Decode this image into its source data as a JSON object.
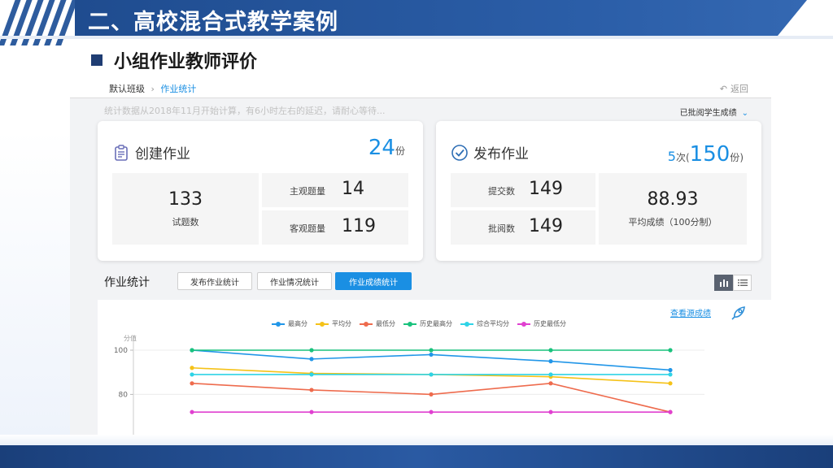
{
  "slide": {
    "title": "二、高校混合式教学案例",
    "subtitle": "小组作业教师评价"
  },
  "topbar": {
    "breadcrumb_root": "默认班级",
    "breadcrumb_sep": "›",
    "breadcrumb_current": "作业统计",
    "back_label": "返回"
  },
  "notice": "统计数据从2018年11月开始计算，有6小时左右的延迟，请耐心等待...",
  "grade_select": "已批阅学生成绩",
  "create_card": {
    "title": "创建作业",
    "total": "24",
    "total_unit": "份",
    "questions_count": "133",
    "questions_label": "试题数",
    "subjective_label": "主观题量",
    "subjective_value": "14",
    "objective_label": "客观题量",
    "objective_value": "119"
  },
  "publish_card": {
    "title": "发布作业",
    "times": "5",
    "times_unit": "次",
    "paren_open": "(",
    "copies": "150",
    "copies_unit": "份",
    "paren_close": ")",
    "submit_label": "提交数",
    "submit_value": "149",
    "review_label": "批阅数",
    "review_value": "149",
    "avg_score": "88.93",
    "avg_label": "平均成绩（100分制）"
  },
  "stats": {
    "section_title": "作业统计",
    "tabs": [
      {
        "label": "发布作业统计",
        "active": false
      },
      {
        "label": "作业情况统计",
        "active": false
      },
      {
        "label": "作业成绩统计",
        "active": true
      }
    ],
    "view_source_link": "查看源成绩"
  },
  "colors": {
    "accent": "#1a8fe3",
    "header_band": "#2b5ea8"
  },
  "chart_data": {
    "type": "line",
    "ylabel": "分值",
    "ylim": [
      70,
      100
    ],
    "yticks": [
      80,
      100
    ],
    "x": [
      1,
      2,
      3,
      4,
      5
    ],
    "legend_position": "top",
    "series": [
      {
        "name": "最高分",
        "color": "#2196e8",
        "values": [
          100,
          96,
          98,
          95,
          91
        ]
      },
      {
        "name": "平均分",
        "color": "#f5c218",
        "values": [
          92,
          89.5,
          89,
          88,
          85
        ]
      },
      {
        "name": "最低分",
        "color": "#ee6b4d",
        "values": [
          85,
          82,
          80,
          85,
          72
        ]
      },
      {
        "name": "历史最高分",
        "color": "#19c27d",
        "values": [
          100,
          100,
          100,
          100,
          100
        ]
      },
      {
        "name": "综合平均分",
        "color": "#2ed3e6",
        "values": [
          89,
          89,
          89,
          89,
          89
        ]
      },
      {
        "name": "历史最低分",
        "color": "#e040d0",
        "values": [
          72,
          72,
          72,
          72,
          72
        ]
      }
    ]
  }
}
